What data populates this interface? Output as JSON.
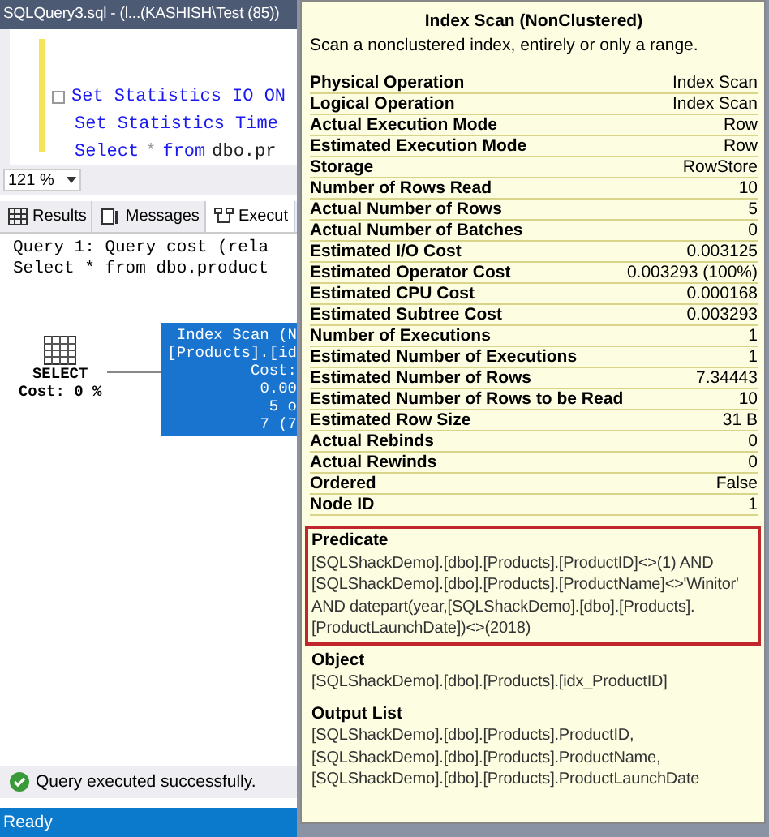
{
  "window": {
    "title": "SQLQuery3.sql - (l...(KASHISH\\Test (85))"
  },
  "editor": {
    "lines": [
      {
        "kind": "fold",
        "parts": [
          {
            "kind": "keyword",
            "text": "Set Statistics IO ON"
          }
        ]
      },
      {
        "kind": "plain",
        "parts": [
          {
            "kind": "keyword",
            "text": "Set Statistics Time"
          }
        ]
      },
      {
        "kind": "plain",
        "parts": [
          {
            "kind": "keyword",
            "text": "Select"
          },
          {
            "kind": "gray",
            "text": "*"
          },
          {
            "kind": "keyword",
            "text": "from"
          },
          {
            "kind": "ident",
            "text": "dbo.pr"
          }
        ]
      }
    ]
  },
  "zoom": {
    "value": "121 %"
  },
  "result_tabs": [
    {
      "label": "Results",
      "selected": false
    },
    {
      "label": "Messages",
      "selected": false
    },
    {
      "label": "Execut",
      "selected": true
    }
  ],
  "query_header": [
    "Query 1: Query cost (rela",
    "Select * from dbo.product"
  ],
  "plan": {
    "select_node": {
      "label": "SELECT",
      "cost": "Cost: 0 %"
    },
    "scan_node": {
      "selected": true,
      "lines": [
        "Index Scan (N",
        "[Products].[id",
        "Cost: ",
        "0.00",
        "5 o",
        "7 (7"
      ]
    }
  },
  "status": {
    "message": "Query executed successfully."
  },
  "status_bar": {
    "text": "Ready"
  },
  "tooltip": {
    "title": "Index Scan (NonClustered)",
    "description": "Scan a nonclustered index, entirely or only a range.",
    "properties": [
      {
        "name": "Physical Operation",
        "value": "Index Scan"
      },
      {
        "name": "Logical Operation",
        "value": "Index Scan"
      },
      {
        "name": "Actual Execution Mode",
        "value": "Row"
      },
      {
        "name": "Estimated Execution Mode",
        "value": "Row"
      },
      {
        "name": "Storage",
        "value": "RowStore"
      },
      {
        "name": "Number of Rows Read",
        "value": "10"
      },
      {
        "name": "Actual Number of Rows",
        "value": "5"
      },
      {
        "name": "Actual Number of Batches",
        "value": "0"
      },
      {
        "name": "Estimated I/O Cost",
        "value": "0.003125"
      },
      {
        "name": "Estimated Operator Cost",
        "value": "0.003293 (100%)"
      },
      {
        "name": "Estimated CPU Cost",
        "value": "0.000168"
      },
      {
        "name": "Estimated Subtree Cost",
        "value": "0.003293"
      },
      {
        "name": "Number of Executions",
        "value": "1"
      },
      {
        "name": "Estimated Number of Executions",
        "value": "1"
      },
      {
        "name": "Estimated Number of Rows",
        "value": "7.34443"
      },
      {
        "name": "Estimated Number of Rows to be Read",
        "value": "10"
      },
      {
        "name": "Estimated Row Size",
        "value": "31 B"
      },
      {
        "name": "Actual Rebinds",
        "value": "0"
      },
      {
        "name": "Actual Rewinds",
        "value": "0"
      },
      {
        "name": "Ordered",
        "value": "False"
      },
      {
        "name": "Node ID",
        "value": "1"
      }
    ],
    "sections": [
      {
        "heading": "Predicate",
        "highlighted": true,
        "lines": [
          "[SQLShackDemo].[dbo].[Products].[ProductID]<>(1) AND",
          "[SQLShackDemo].[dbo].[Products].[ProductName]<>'Winitor'",
          "AND datepart(year,[SQLShackDemo].[dbo].[Products].",
          "[ProductLaunchDate])<>(2018)"
        ]
      },
      {
        "heading": "Object",
        "highlighted": false,
        "lines": [
          "[SQLShackDemo].[dbo].[Products].[idx_ProductID]"
        ]
      },
      {
        "heading": "Output List",
        "highlighted": false,
        "lines": [
          "[SQLShackDemo].[dbo].[Products].ProductID,",
          "[SQLShackDemo].[dbo].[Products].ProductName,",
          "[SQLShackDemo].[dbo].[Products].ProductLaunchDate"
        ]
      }
    ]
  }
}
